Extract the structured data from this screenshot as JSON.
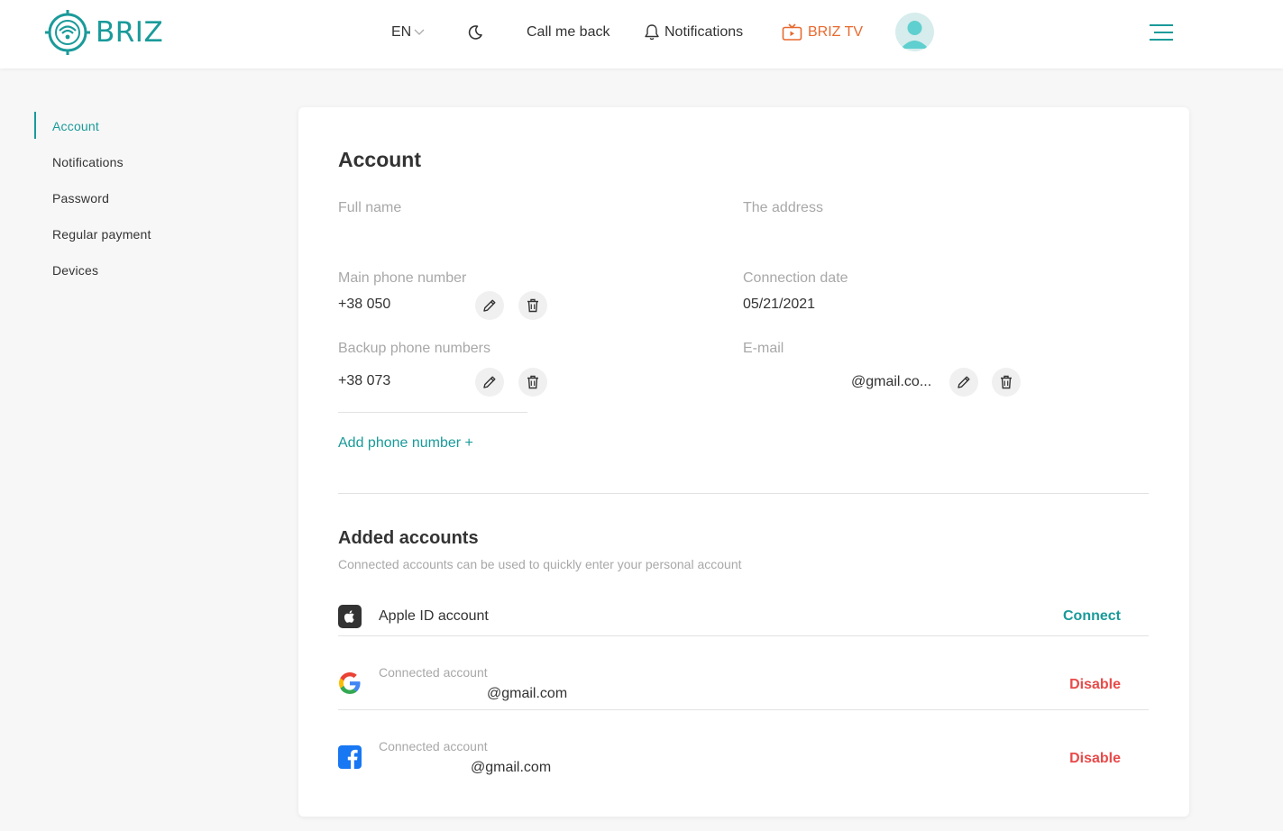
{
  "header": {
    "logo_text": "BRIZ",
    "language": "EN",
    "call_back": "Call me back",
    "notifications": "Notifications",
    "briz_tv": "BRIZ TV",
    "colors": {
      "brand": "#1a9a9a",
      "tv": "#e8692e"
    }
  },
  "sidebar": {
    "items": [
      {
        "label": "Account",
        "active": true
      },
      {
        "label": "Notifications"
      },
      {
        "label": "Password"
      },
      {
        "label": "Regular payment"
      },
      {
        "label": "Devices"
      }
    ]
  },
  "account": {
    "title": "Account",
    "full_name_label": "Full name",
    "address_label": "The address",
    "main_phone_label": "Main phone number",
    "main_phone_value": "+38 050",
    "connection_date_label": "Connection date",
    "connection_date_value": "05/21/2021",
    "backup_phone_label": "Backup phone numbers",
    "backup_phone_value": "+38 073",
    "email_label": "E-mail",
    "email_value": "@gmail.co...",
    "add_phone": "Add phone number +"
  },
  "added_accounts": {
    "title": "Added accounts",
    "subtitle": "Connected accounts can be used to quickly enter your personal account",
    "apple": {
      "label": "Apple ID account",
      "action": "Connect"
    },
    "google": {
      "status": "Connected account",
      "email": "@gmail.com",
      "action": "Disable"
    },
    "facebook": {
      "status": "Connected account",
      "email": "@gmail.com",
      "action": "Disable"
    },
    "colors": {
      "disable": "#e84a4a",
      "connect": "#1a9a9a"
    }
  }
}
